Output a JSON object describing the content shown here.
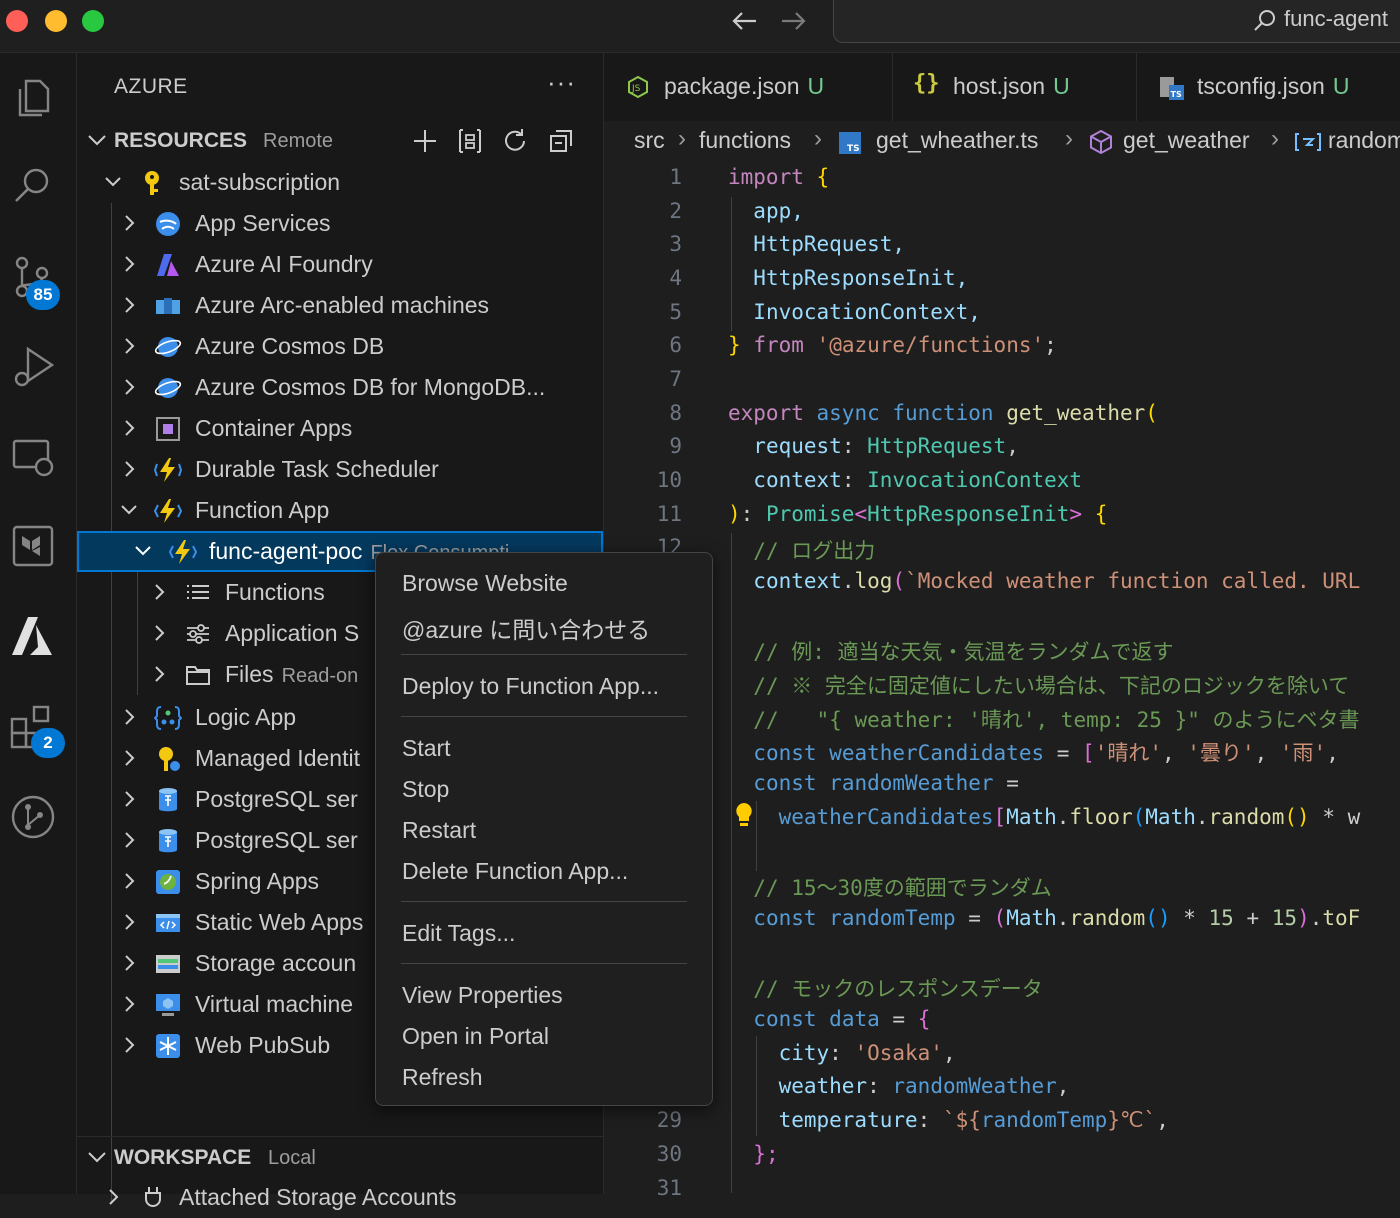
{
  "titlebar": {
    "command_center_text": "func-agent",
    "back_icon": "arrow-left-icon",
    "forward_icon": "arrow-right-icon"
  },
  "activity_bar": {
    "scm_badge": "85",
    "extensions_badge": "2"
  },
  "sidebar": {
    "title": "AZURE",
    "more": "···",
    "resources_header": "RESOURCES",
    "resources_sub": "Remote",
    "subscription": "sat-subscription",
    "items": [
      {
        "label": "App Services",
        "icon": "app-services-icon"
      },
      {
        "label": "Azure AI Foundry",
        "icon": "ai-foundry-icon"
      },
      {
        "label": "Azure Arc-enabled machines",
        "icon": "arc-machines-icon"
      },
      {
        "label": "Azure Cosmos DB",
        "icon": "cosmos-db-icon"
      },
      {
        "label": "Azure Cosmos DB for MongoDB...",
        "icon": "cosmos-mongo-icon"
      },
      {
        "label": "Container Apps",
        "icon": "container-apps-icon"
      },
      {
        "label": "Durable Task Scheduler",
        "icon": "durable-task-icon"
      },
      {
        "label": "Function App",
        "icon": "function-app-icon"
      }
    ],
    "function_app_child": {
      "label": "func-agent-poc",
      "desc": "Flex Consumpti..."
    },
    "function_children": [
      {
        "label": "Functions",
        "desc": ""
      },
      {
        "label": "Application S",
        "desc": ""
      },
      {
        "label": "Files",
        "desc": "Read-on"
      }
    ],
    "items_after": [
      {
        "label": "Logic App"
      },
      {
        "label": "Managed Identit"
      },
      {
        "label": "PostgreSQL ser"
      },
      {
        "label": "PostgreSQL ser"
      },
      {
        "label": "Spring Apps"
      },
      {
        "label": "Static Web Apps"
      },
      {
        "label": "Storage accoun"
      },
      {
        "label": "Virtual machine"
      },
      {
        "label": "Web PubSub"
      }
    ],
    "workspace_header": "WORKSPACE",
    "workspace_sub": "Local",
    "workspace_item": "Attached Storage Accounts"
  },
  "tabs": [
    {
      "name": "package.json",
      "status": "U"
    },
    {
      "name": "host.json",
      "status": "U"
    },
    {
      "name": "tsconfig.json",
      "status": "U"
    }
  ],
  "breadcrumb": [
    "src",
    "functions",
    "get_wheather.ts",
    "get_weather",
    "random"
  ],
  "line_numbers": [
    "1",
    "2",
    "3",
    "4",
    "5",
    "6",
    "7",
    "8",
    "9",
    "10",
    "11",
    "12",
    "29",
    "30",
    "31"
  ],
  "context_menu": {
    "groups": [
      [
        "Browse Website",
        "@azure に問い合わせる"
      ],
      [
        "Deploy to Function App..."
      ],
      [
        "Start",
        "Stop",
        "Restart",
        "Delete Function App..."
      ],
      [
        "Edit Tags..."
      ],
      [
        "View Properties",
        "Open in Portal",
        "Refresh"
      ]
    ]
  },
  "code": {
    "l1": "import",
    "l2": "app,",
    "l3": "HttpRequest,",
    "l4": "HttpResponseInit,",
    "l5": "InvocationContext,",
    "l6_from": "from",
    "l6_str": "'@azure/functions'",
    "l8_export": "export",
    "l8_async": "async",
    "l8_function": "function",
    "l8_name": "get_weather",
    "l9_param": "request",
    "l9_type": "HttpRequest",
    "l10_param": "context",
    "l10_type": "InvocationContext",
    "l11_promise": "Promise",
    "l11_type": "HttpResponseInit",
    "l12_comment": "// ログ出力",
    "l13_ctx": "context",
    "l13_log": "log",
    "l13_str": "`Mocked weather function called. URL",
    "l15_comment": "// 例: 適当な天気・気温をランダムで返す",
    "l16_comment": "// ※ 完全に固定値にしたい場合は、下記のロジックを除いて",
    "l17_comment": "//   \"{ weather: '晴れ', temp: 25 }\" のようにベタ書",
    "l18_const": "const",
    "l18_var": "weatherCandidates",
    "l18_s1": "'晴れ'",
    "l18_s2": "'曇り'",
    "l18_s3": "'雨'",
    "l19_const": "const",
    "l19_var": "randomWeather",
    "l20_var": "weatherCandidates",
    "l20_math": "Math",
    "l20_floor": "floor",
    "l20_math2": "Math",
    "l20_random": "random",
    "l20_tail": " * w",
    "l22_comment": "// 15〜30度の範囲でランダム",
    "l23_const": "const",
    "l23_var": "randomTemp",
    "l23_math": "Math",
    "l23_random": "random",
    "l23_n1": "15",
    "l23_n2": "15",
    "l23_tail": "toF",
    "l25_comment": "// モックのレスポンスデータ",
    "l26_const": "const",
    "l26_var": "data",
    "l27_key": "city",
    "l27_val": "'Osaka'",
    "l28_key": "weather",
    "l28_val": "randomWeather",
    "l29_key": "temperature",
    "l29_pre": "`${",
    "l29_var": "randomTemp",
    "l29_post": "}℃`",
    "l30": "};"
  }
}
